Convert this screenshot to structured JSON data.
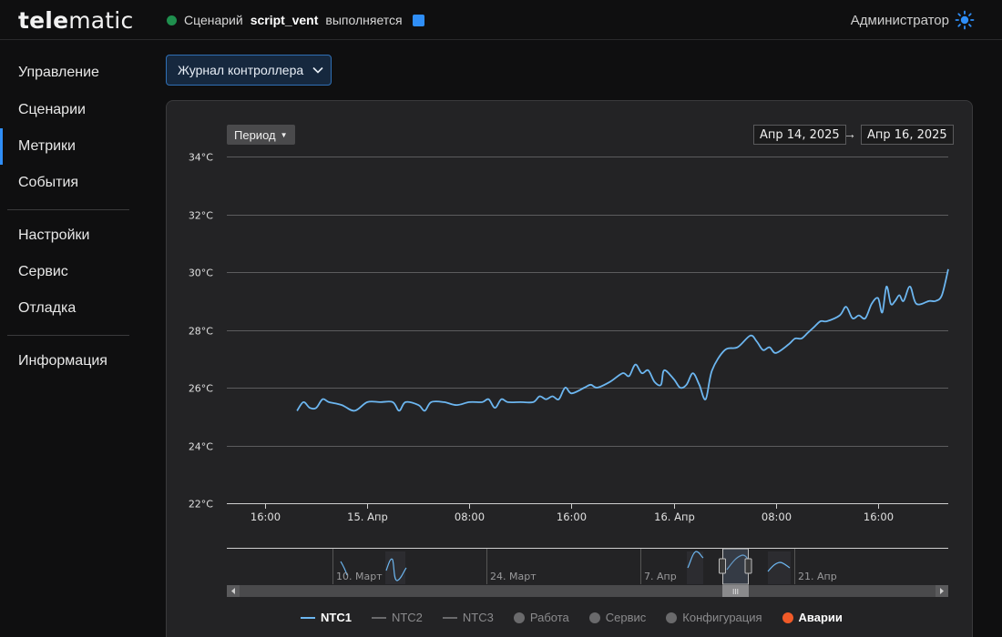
{
  "app": {
    "logo_bold": "tele",
    "logo_light": "matic"
  },
  "status": {
    "prefix": "Сценарий",
    "scenario": "script_vent",
    "suffix": "выполняется",
    "dot_color": "#1f8f4e",
    "indicator_color": "#2f8ef7"
  },
  "user": {
    "name": "Администратор",
    "theme_icon": "sun-icon"
  },
  "sidebar": {
    "items": [
      {
        "label": "Управление"
      },
      {
        "label": "Сценарии"
      },
      {
        "label": "Метрики",
        "active": true
      },
      {
        "label": "События"
      },
      {
        "label": "Настройки"
      },
      {
        "label": "Сервис"
      },
      {
        "label": "Отладка"
      },
      {
        "label": "Информация"
      }
    ]
  },
  "journal": {
    "label": "Журнал контроллера",
    "icon": "chevron-down-icon"
  },
  "controls": {
    "period_label": "Период",
    "date_from": "Апр 14, 2025",
    "arrow": "→",
    "date_to": "Апр 16, 2025"
  },
  "navigator": {
    "labels": [
      "10. Март",
      "24. Март",
      "7. Апр",
      "21. Апр"
    ],
    "grip": "III"
  },
  "legend": [
    {
      "label": "NTC1",
      "kind": "line",
      "color": "#6cb6f0",
      "active": true
    },
    {
      "label": "NTC2",
      "kind": "line",
      "color": "#6a6a6c",
      "active": false
    },
    {
      "label": "NTC3",
      "kind": "line",
      "color": "#6a6a6c",
      "active": false
    },
    {
      "label": "Работа",
      "kind": "dot",
      "color": "#6a6a6c",
      "active": false
    },
    {
      "label": "Сервис",
      "kind": "dot",
      "color": "#6a6a6c",
      "active": false
    },
    {
      "label": "Конфигурация",
      "kind": "dot",
      "color": "#6a6a6c",
      "active": false
    },
    {
      "label": "Аварии",
      "kind": "dot",
      "color": "#f05a28",
      "active": true
    }
  ],
  "chart_data": {
    "type": "line",
    "title": "",
    "xlabel": "",
    "ylabel": "",
    "y_unit": "°C",
    "ylim": [
      22,
      34
    ],
    "y_ticks": [
      "22°C",
      "24°C",
      "26°C",
      "28°C",
      "30°C",
      "32°C",
      "34°C"
    ],
    "x_range": [
      "2025-04-14 13:00",
      "2025-04-16 21:30"
    ],
    "x_ticks": [
      "16:00",
      "15. Апр",
      "08:00",
      "16:00",
      "16. Апр",
      "08:00",
      "16:00"
    ],
    "grid": true,
    "legend_position": "bottom",
    "series": [
      {
        "name": "NTC1",
        "color": "#6cb6f0",
        "points": [
          [
            "2025-04-14 18:30",
            25.2
          ],
          [
            "2025-04-14 19:00",
            25.5
          ],
          [
            "2025-04-14 19:30",
            25.3
          ],
          [
            "2025-04-14 20:00",
            25.3
          ],
          [
            "2025-04-14 20:30",
            25.6
          ],
          [
            "2025-04-14 21:00",
            25.5
          ],
          [
            "2025-04-14 22:00",
            25.4
          ],
          [
            "2025-04-14 23:00",
            25.2
          ],
          [
            "2025-04-15 00:00",
            25.5
          ],
          [
            "2025-04-15 01:00",
            25.5
          ],
          [
            "2025-04-15 02:00",
            25.5
          ],
          [
            "2025-04-15 02:30",
            25.2
          ],
          [
            "2025-04-15 03:00",
            25.5
          ],
          [
            "2025-04-15 04:00",
            25.4
          ],
          [
            "2025-04-15 04:30",
            25.2
          ],
          [
            "2025-04-15 05:00",
            25.5
          ],
          [
            "2025-04-15 06:00",
            25.5
          ],
          [
            "2025-04-15 07:00",
            25.4
          ],
          [
            "2025-04-15 08:00",
            25.5
          ],
          [
            "2025-04-15 09:00",
            25.5
          ],
          [
            "2025-04-15 09:30",
            25.6
          ],
          [
            "2025-04-15 10:00",
            25.3
          ],
          [
            "2025-04-15 10:30",
            25.6
          ],
          [
            "2025-04-15 11:00",
            25.5
          ],
          [
            "2025-04-15 12:00",
            25.5
          ],
          [
            "2025-04-15 13:00",
            25.5
          ],
          [
            "2025-04-15 13:30",
            25.7
          ],
          [
            "2025-04-15 14:00",
            25.6
          ],
          [
            "2025-04-15 14:30",
            25.7
          ],
          [
            "2025-04-15 15:00",
            25.6
          ],
          [
            "2025-04-15 15:30",
            26.0
          ],
          [
            "2025-04-15 16:00",
            25.8
          ],
          [
            "2025-04-15 17:00",
            26.0
          ],
          [
            "2025-04-15 17:30",
            26.1
          ],
          [
            "2025-04-15 18:00",
            26.0
          ],
          [
            "2025-04-15 19:00",
            26.2
          ],
          [
            "2025-04-15 20:00",
            26.5
          ],
          [
            "2025-04-15 20:30",
            26.4
          ],
          [
            "2025-04-15 21:00",
            26.8
          ],
          [
            "2025-04-15 21:30",
            26.5
          ],
          [
            "2025-04-15 22:00",
            26.6
          ],
          [
            "2025-04-15 22:30",
            26.2
          ],
          [
            "2025-04-15 23:00",
            26.1
          ],
          [
            "2025-04-15 23:15",
            26.6
          ],
          [
            "2025-04-16 00:00",
            26.3
          ],
          [
            "2025-04-16 00:30",
            26.0
          ],
          [
            "2025-04-16 01:00",
            26.1
          ],
          [
            "2025-04-16 01:30",
            26.5
          ],
          [
            "2025-04-16 02:00",
            26.1
          ],
          [
            "2025-04-16 02:30",
            25.6
          ],
          [
            "2025-04-16 03:00",
            26.6
          ],
          [
            "2025-04-16 04:00",
            27.3
          ],
          [
            "2025-04-16 05:00",
            27.4
          ],
          [
            "2025-04-16 06:00",
            27.8
          ],
          [
            "2025-04-16 06:30",
            27.6
          ],
          [
            "2025-04-16 07:00",
            27.3
          ],
          [
            "2025-04-16 07:30",
            27.4
          ],
          [
            "2025-04-16 08:00",
            27.2
          ],
          [
            "2025-04-16 09:00",
            27.5
          ],
          [
            "2025-04-16 09:30",
            27.7
          ],
          [
            "2025-04-16 10:00",
            27.7
          ],
          [
            "2025-04-16 10:30",
            27.9
          ],
          [
            "2025-04-16 11:00",
            28.1
          ],
          [
            "2025-04-16 11:30",
            28.3
          ],
          [
            "2025-04-16 12:00",
            28.3
          ],
          [
            "2025-04-16 13:00",
            28.5
          ],
          [
            "2025-04-16 13:30",
            28.8
          ],
          [
            "2025-04-16 14:00",
            28.4
          ],
          [
            "2025-04-16 14:30",
            28.5
          ],
          [
            "2025-04-16 15:00",
            28.4
          ],
          [
            "2025-04-16 15:30",
            28.9
          ],
          [
            "2025-04-16 16:00",
            29.1
          ],
          [
            "2025-04-16 16:20",
            28.6
          ],
          [
            "2025-04-16 16:40",
            29.5
          ],
          [
            "2025-04-16 17:00",
            28.9
          ],
          [
            "2025-04-16 17:20",
            29.0
          ],
          [
            "2025-04-16 17:40",
            29.2
          ],
          [
            "2025-04-16 18:00",
            29.0
          ],
          [
            "2025-04-16 18:30",
            29.5
          ],
          [
            "2025-04-16 19:00",
            28.9
          ],
          [
            "2025-04-16 20:00",
            29.0
          ],
          [
            "2025-04-16 20:30",
            29.0
          ],
          [
            "2025-04-16 21:00",
            29.2
          ],
          [
            "2025-04-16 21:30",
            30.1
          ]
        ]
      }
    ]
  }
}
